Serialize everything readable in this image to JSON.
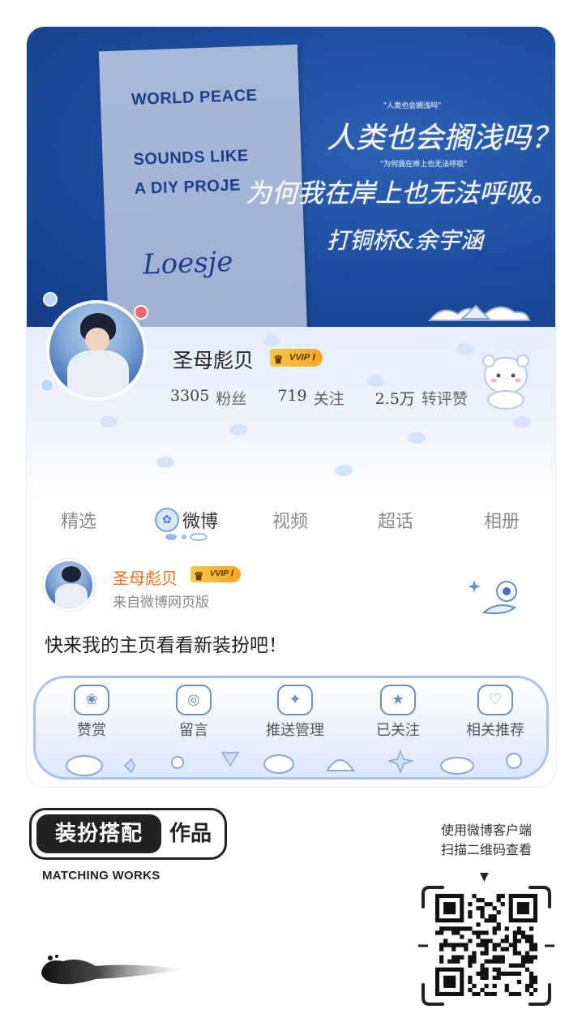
{
  "banner": {
    "poster_lines": [
      "WORLD PEACE",
      "SOUNDS LIKE",
      "A DIY PROJE"
    ],
    "poster_signature": "Loesje",
    "calligraphy": [
      "人类也会搁浅吗？",
      "为何我在岸上也无法呼吸。",
      "打铜桥&余宇涵"
    ],
    "small_captions": [
      "\"人类也会搁浅吗\"",
      "\"为何我在岸上也无法呼吸\""
    ]
  },
  "profile": {
    "name": "圣母彪贝",
    "vip_badge": "VVIP Ⅰ",
    "stats": [
      {
        "value": "3305",
        "label": "粉丝"
      },
      {
        "value": "719",
        "label": "关注"
      },
      {
        "value": "2.5万",
        "label": "转评赞"
      }
    ]
  },
  "tabs": [
    "精选",
    "微博",
    "视频",
    "超话",
    "相册"
  ],
  "active_tab": "微博",
  "post": {
    "author": "圣母彪贝",
    "vip_badge": "VVIP Ⅰ",
    "source": "来自微博网页版",
    "text": "快来我的主页看看新装扮吧！"
  },
  "actions": [
    "赞赏",
    "留言",
    "推送管理",
    "已关注",
    "相关推荐"
  ],
  "footer": {
    "badge_dark": "装扮搭配",
    "badge_light": "作品",
    "subtitle": "MATCHING WORKS",
    "scan_line1": "使用微博客户端",
    "scan_line2": "扫描二维码查看"
  },
  "colors": {
    "banner_blue": "#1c4c9d",
    "author_orange": "#e8701f",
    "vip_gold": "#f3a722",
    "accent_blue": "#6c8fc6"
  }
}
